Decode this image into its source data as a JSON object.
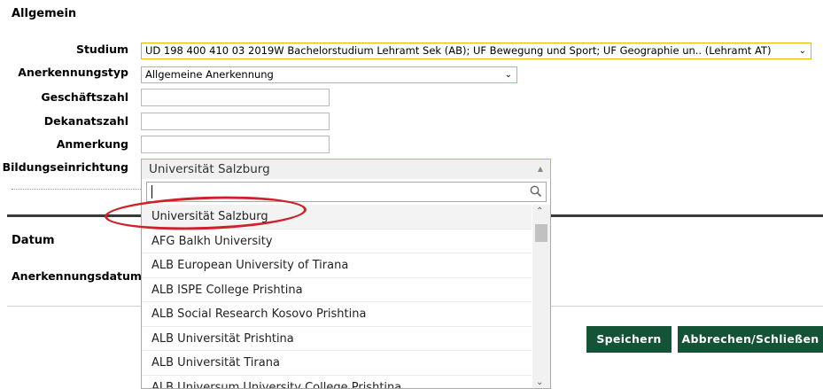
{
  "sections": {
    "allgemein": "Allgemein",
    "datum": "Datum"
  },
  "fields": {
    "studium_label": "Studium",
    "studium_value": "UD 198 400 410 03 2019W Bachelorstudium Lehramt Sek (AB); UF Bewegung und Sport; UF Geographie un.. (Lehramt AT)",
    "anerkennungstyp_label": "Anerkennungstyp",
    "anerkennungstyp_value": "Allgemeine Anerkennung",
    "geschaeftszahl_label": "Geschäftszahl",
    "dekanatszahl_label": "Dekanatszahl",
    "anmerkung_label": "Anmerkung",
    "bildungseinrichtung_label": "Bildungseinrichtung",
    "bildungseinrichtung_value": "Universität Salzburg",
    "anerkennungsdatum_label": "Anerkennungsdatum"
  },
  "dropdown": {
    "search_value": "",
    "items": [
      "Universität Salzburg",
      "AFG Balkh University",
      "ALB European University of Tirana",
      "ALB ISPE College Prishtina",
      "ALB Social Research Kosovo Prishtina",
      "ALB Universität Prishtina",
      "ALB Universität Tirana",
      "ALB Universum University College Prishtina"
    ]
  },
  "buttons": {
    "save": "Speichern",
    "cancel": "Abbrechen/Schließen"
  },
  "colors": {
    "button_bg": "#155337",
    "field_border": "#e6b800",
    "highlight": "#d0202a"
  }
}
